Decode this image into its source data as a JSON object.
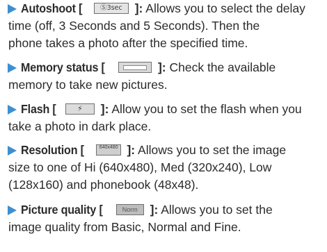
{
  "items": [
    {
      "title": "Autoshoot [",
      "icon_label": "Ⓢ3sec",
      "after": "]:",
      "lines": [
        "Allows you to select the delay",
        "time (off, 3 Seconds and 5 Seconds). Then the",
        "phone takes a photo after the specified time."
      ]
    },
    {
      "title": "Memory status [",
      "icon_label": "",
      "after": "]:",
      "lines": [
        "Check the available",
        "memory to take new pictures."
      ]
    },
    {
      "title": "Flash [",
      "icon_label": "⚡",
      "after": "]:",
      "lines": [
        "Allow you to set the flash when you",
        "take a photo in dark place."
      ]
    },
    {
      "title": "Resolution [",
      "icon_label": "640x480",
      "after": "]:",
      "lines": [
        "Allows you to set the image",
        "size to one of Hi (640x480), Med (320x240), Low",
        "(128x160) and phonebook (48x48)."
      ]
    },
    {
      "title": "Picture quality [",
      "icon_label": "Norm",
      "after": "]:",
      "lines": [
        "Allows you to set the",
        "image quality from Basic, Normal and Fine."
      ]
    }
  ],
  "colors": {
    "bullet": "#3d8fd1",
    "text": "#2b2b2b"
  }
}
